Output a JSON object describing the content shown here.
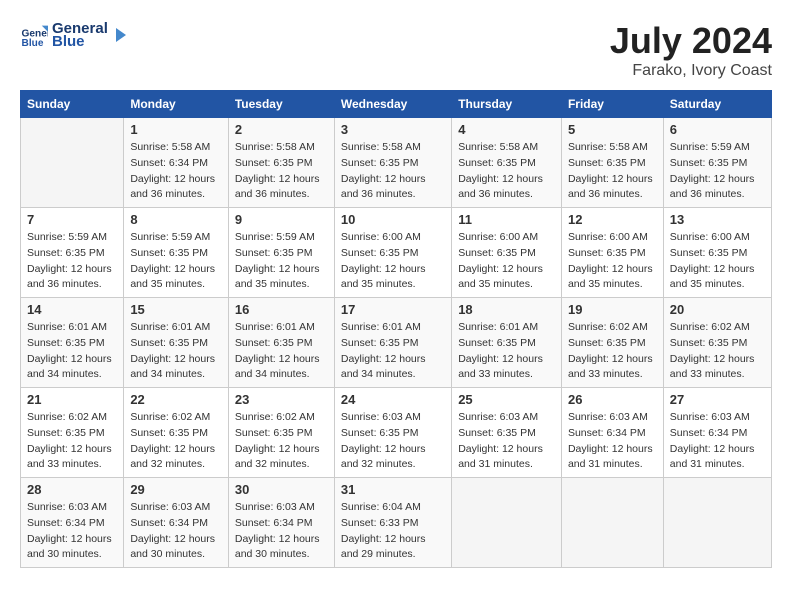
{
  "logo": {
    "text_general": "General",
    "text_blue": "Blue"
  },
  "title": "July 2024",
  "subtitle": "Farako, Ivory Coast",
  "days_of_week": [
    "Sunday",
    "Monday",
    "Tuesday",
    "Wednesday",
    "Thursday",
    "Friday",
    "Saturday"
  ],
  "weeks": [
    [
      {
        "day": "",
        "empty": true
      },
      {
        "day": "1",
        "sunrise": "5:58 AM",
        "sunset": "6:34 PM",
        "daylight": "12 hours and 36 minutes."
      },
      {
        "day": "2",
        "sunrise": "5:58 AM",
        "sunset": "6:35 PM",
        "daylight": "12 hours and 36 minutes."
      },
      {
        "day": "3",
        "sunrise": "5:58 AM",
        "sunset": "6:35 PM",
        "daylight": "12 hours and 36 minutes."
      },
      {
        "day": "4",
        "sunrise": "5:58 AM",
        "sunset": "6:35 PM",
        "daylight": "12 hours and 36 minutes."
      },
      {
        "day": "5",
        "sunrise": "5:58 AM",
        "sunset": "6:35 PM",
        "daylight": "12 hours and 36 minutes."
      },
      {
        "day": "6",
        "sunrise": "5:59 AM",
        "sunset": "6:35 PM",
        "daylight": "12 hours and 36 minutes."
      }
    ],
    [
      {
        "day": "7",
        "sunrise": "5:59 AM",
        "sunset": "6:35 PM",
        "daylight": "12 hours and 36 minutes."
      },
      {
        "day": "8",
        "sunrise": "5:59 AM",
        "sunset": "6:35 PM",
        "daylight": "12 hours and 35 minutes."
      },
      {
        "day": "9",
        "sunrise": "5:59 AM",
        "sunset": "6:35 PM",
        "daylight": "12 hours and 35 minutes."
      },
      {
        "day": "10",
        "sunrise": "6:00 AM",
        "sunset": "6:35 PM",
        "daylight": "12 hours and 35 minutes."
      },
      {
        "day": "11",
        "sunrise": "6:00 AM",
        "sunset": "6:35 PM",
        "daylight": "12 hours and 35 minutes."
      },
      {
        "day": "12",
        "sunrise": "6:00 AM",
        "sunset": "6:35 PM",
        "daylight": "12 hours and 35 minutes."
      },
      {
        "day": "13",
        "sunrise": "6:00 AM",
        "sunset": "6:35 PM",
        "daylight": "12 hours and 35 minutes."
      }
    ],
    [
      {
        "day": "14",
        "sunrise": "6:01 AM",
        "sunset": "6:35 PM",
        "daylight": "12 hours and 34 minutes."
      },
      {
        "day": "15",
        "sunrise": "6:01 AM",
        "sunset": "6:35 PM",
        "daylight": "12 hours and 34 minutes."
      },
      {
        "day": "16",
        "sunrise": "6:01 AM",
        "sunset": "6:35 PM",
        "daylight": "12 hours and 34 minutes."
      },
      {
        "day": "17",
        "sunrise": "6:01 AM",
        "sunset": "6:35 PM",
        "daylight": "12 hours and 34 minutes."
      },
      {
        "day": "18",
        "sunrise": "6:01 AM",
        "sunset": "6:35 PM",
        "daylight": "12 hours and 33 minutes."
      },
      {
        "day": "19",
        "sunrise": "6:02 AM",
        "sunset": "6:35 PM",
        "daylight": "12 hours and 33 minutes."
      },
      {
        "day": "20",
        "sunrise": "6:02 AM",
        "sunset": "6:35 PM",
        "daylight": "12 hours and 33 minutes."
      }
    ],
    [
      {
        "day": "21",
        "sunrise": "6:02 AM",
        "sunset": "6:35 PM",
        "daylight": "12 hours and 33 minutes."
      },
      {
        "day": "22",
        "sunrise": "6:02 AM",
        "sunset": "6:35 PM",
        "daylight": "12 hours and 32 minutes."
      },
      {
        "day": "23",
        "sunrise": "6:02 AM",
        "sunset": "6:35 PM",
        "daylight": "12 hours and 32 minutes."
      },
      {
        "day": "24",
        "sunrise": "6:03 AM",
        "sunset": "6:35 PM",
        "daylight": "12 hours and 32 minutes."
      },
      {
        "day": "25",
        "sunrise": "6:03 AM",
        "sunset": "6:35 PM",
        "daylight": "12 hours and 31 minutes."
      },
      {
        "day": "26",
        "sunrise": "6:03 AM",
        "sunset": "6:34 PM",
        "daylight": "12 hours and 31 minutes."
      },
      {
        "day": "27",
        "sunrise": "6:03 AM",
        "sunset": "6:34 PM",
        "daylight": "12 hours and 31 minutes."
      }
    ],
    [
      {
        "day": "28",
        "sunrise": "6:03 AM",
        "sunset": "6:34 PM",
        "daylight": "12 hours and 30 minutes."
      },
      {
        "day": "29",
        "sunrise": "6:03 AM",
        "sunset": "6:34 PM",
        "daylight": "12 hours and 30 minutes."
      },
      {
        "day": "30",
        "sunrise": "6:03 AM",
        "sunset": "6:34 PM",
        "daylight": "12 hours and 30 minutes."
      },
      {
        "day": "31",
        "sunrise": "6:04 AM",
        "sunset": "6:33 PM",
        "daylight": "12 hours and 29 minutes."
      },
      {
        "day": "",
        "empty": true
      },
      {
        "day": "",
        "empty": true
      },
      {
        "day": "",
        "empty": true
      }
    ]
  ]
}
